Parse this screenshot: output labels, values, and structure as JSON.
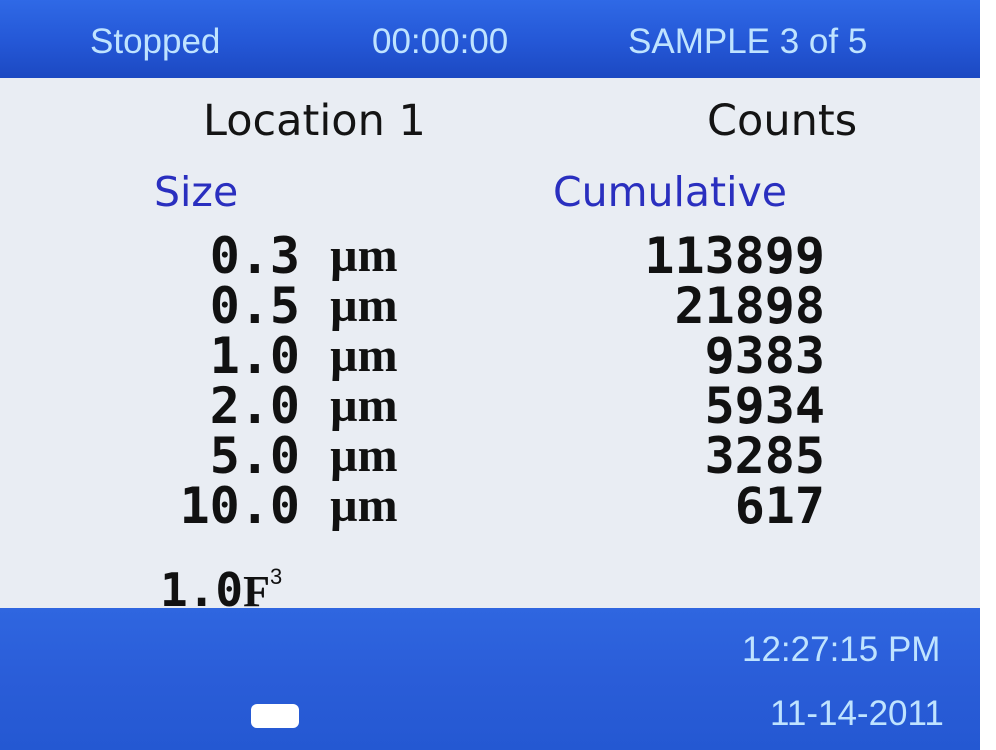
{
  "status_bar": {
    "state": "Stopped",
    "timer": "00:00:00",
    "sample": "SAMPLE 3 of 5"
  },
  "header": {
    "location": "Location 1",
    "counts": "Counts"
  },
  "columns": {
    "size_label": "Size",
    "mode_label": "Cumulative"
  },
  "rows": [
    {
      "size": "0.3",
      "unit": "µm",
      "count": "113899"
    },
    {
      "size": "0.5",
      "unit": "µm",
      "count": "21898"
    },
    {
      "size": "1.0",
      "unit": "µm",
      "count": "9383"
    },
    {
      "size": "2.0",
      "unit": "µm",
      "count": "5934"
    },
    {
      "size": "5.0",
      "unit": "µm",
      "count": "3285"
    },
    {
      "size": "10.0",
      "unit": "µm",
      "count": "617"
    }
  ],
  "volume": {
    "value": "1.0",
    "unit": "F",
    "exponent": "3"
  },
  "footer": {
    "time": "12:27:15 PM",
    "date": "11-14-2011",
    "battery_icon": "battery-icon"
  },
  "colors": {
    "bar_blue": "#2a5dd8",
    "bar_text": "#bfe3ff",
    "screen_bg": "#e9edf3",
    "label_blue": "#2a2fbf",
    "text_dark": "#111111"
  }
}
